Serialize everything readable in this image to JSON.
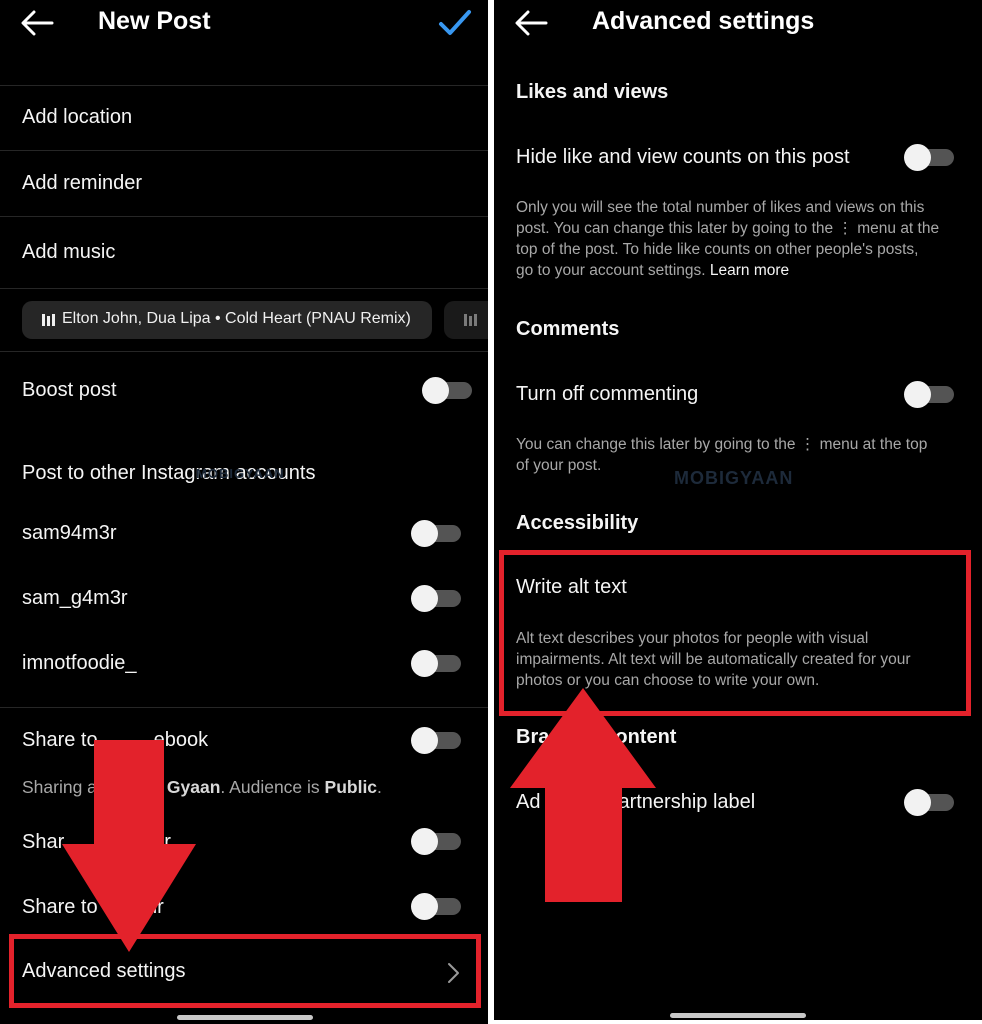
{
  "left_screen": {
    "title": "New Post",
    "back_icon": "arrow-left-icon",
    "confirm_icon": "checkmark-icon",
    "colors": {
      "accent": "#3897f0",
      "background": "#000000",
      "chip": "#262626",
      "toggle_track": "#545454",
      "toggle_knob": "#f2f2f2"
    },
    "menu_items": [
      {
        "label": "Add location"
      },
      {
        "label": "Add reminder"
      },
      {
        "label": "Add music"
      }
    ],
    "music_chip": {
      "icon": "audio-bars-icon",
      "text": "Elton John, Dua Lipa • Cold Heart (PNAU Remix)"
    },
    "boost_post": {
      "label": "Boost post",
      "enabled": false
    },
    "other_accounts": {
      "heading": "Post to other Instagram accounts",
      "accounts": [
        {
          "name": "sam94m3r",
          "enabled": false
        },
        {
          "name": "sam_g4m3r",
          "enabled": false
        },
        {
          "name": "imnotfoodie_",
          "enabled": false
        }
      ]
    },
    "share_facebook": {
      "label_visible_start": "Share to",
      "label_visible_end": "ebook",
      "enabled": false,
      "subtext_prefix": "Sharing a",
      "subtext_bold_1": "Gyaan",
      "subtext_middle": ". Audience is ",
      "subtext_bold_2": "Public",
      "subtext_suffix": "."
    },
    "share_twitter": {
      "label_visible_start": "Shar",
      "label_visible_end": "r",
      "enabled": false
    },
    "share_tumblr": {
      "label_visible_start": "Share to",
      "label_visible_end": "blr",
      "enabled": false
    },
    "advanced_settings": {
      "label": "Advanced settings",
      "chevron_icon": "chevron-right-icon"
    }
  },
  "right_screen": {
    "title": "Advanced settings",
    "back_icon": "arrow-left-icon",
    "sections": {
      "likes": {
        "heading": "Likes and views",
        "toggle_label": "Hide like and view counts on this post",
        "enabled": false,
        "description_line1": "Only you will see the total number of likes and views on this",
        "description_line2": "post. You can change this later by going to the ⋮ menu at the",
        "description_line3": "top of the post. To hide like counts on other people's posts,",
        "description_line4": "go to your account settings.",
        "learn_more": "Learn more"
      },
      "comments": {
        "heading": "Comments",
        "toggle_label": "Turn off commenting",
        "enabled": false,
        "description_line1": "You can change this later by going to the ⋮ menu at the top",
        "description_line2": "of your post."
      },
      "accessibility": {
        "heading": "Accessibility",
        "item_label": "Write alt text",
        "description_line1": "Alt text describes your photos for people with visual",
        "description_line2": "impairments. Alt text will be automatically created for your",
        "description_line3": "photos or you can choose to write your own."
      },
      "branded": {
        "heading_visible_start": "Bra",
        "heading_visible_end": "ontent",
        "toggle_label_visible_start": "Ad",
        "toggle_label_visible_end": "artnership label",
        "enabled": false
      }
    },
    "watermark": "MOBIGYAAN"
  },
  "annotations": {
    "color": "#e3222b",
    "left_arrow": "arrow-down-annotation",
    "right_arrow": "arrow-up-annotation"
  }
}
